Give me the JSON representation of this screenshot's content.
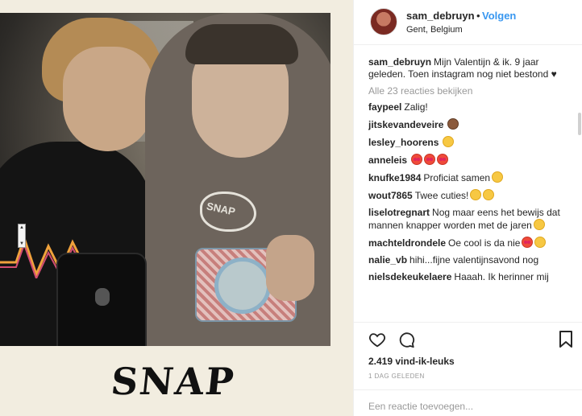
{
  "post": {
    "caption_art": "SNAP",
    "shirt_text": "SNAP"
  },
  "header": {
    "username": "sam_debruyn",
    "separator": "•",
    "follow_label": "Volgen",
    "location": "Gent, Belgium"
  },
  "caption": {
    "username": "sam_debruyn",
    "text": "Mijn Valentijn & ik. 9 jaar geleden. Toen instagram nog niet bestond ♥"
  },
  "view_all_comments": "Alle 23 reacties bekijken",
  "comments": [
    {
      "username": "faypeel",
      "text": "Zalig!",
      "emoji": []
    },
    {
      "username": "jitskevandeveire",
      "text": "",
      "emoji": [
        "see-no-evil-monkey"
      ]
    },
    {
      "username": "lesley_hoorens",
      "text": "",
      "emoji": [
        "grinning-face"
      ]
    },
    {
      "username": "anneleis",
      "text": "",
      "emoji": [
        "heart-eyes",
        "heart-eyes",
        "heart-eyes"
      ]
    },
    {
      "username": "knufke1984",
      "text": "Proficiat samen",
      "emoji": [
        "smiling-face"
      ]
    },
    {
      "username": "wout7865",
      "text": "Twee cuties!",
      "emoji": [
        "grinning-face",
        "smiling-face"
      ]
    },
    {
      "username": "liselotregnart",
      "text": "Nog maar eens het bewijs dat mannen knapper worden met de jaren",
      "emoji": [
        "tongue-face"
      ]
    },
    {
      "username": "machteldrondele",
      "text": "Oe cool is da nie",
      "emoji": [
        "heart-eyes",
        "grinning-face"
      ]
    },
    {
      "username": "nalie_vb",
      "text": "hihi...fijne valentijnsavond nog",
      "emoji": []
    },
    {
      "username": "nielsdekeukelaere",
      "text": "Haaah. Ik herinner mij",
      "emoji": []
    }
  ],
  "likes": "2.419 vind-ik-leuks",
  "date": "1 DAG GELEDEN",
  "comment_input": {
    "placeholder": "Een reactie toevoegen..."
  },
  "colors": {
    "accent": "#3897f0",
    "text": "#262626",
    "muted": "#999999",
    "border": "#efefef"
  }
}
